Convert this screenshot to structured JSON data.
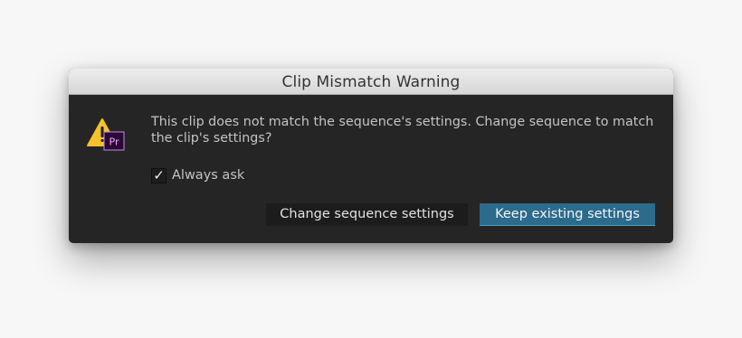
{
  "dialog": {
    "title": "Clip Mismatch Warning",
    "icon": "warning-premiere-icon",
    "message": "This clip does not match the sequence's settings. Change sequence to match the clip's settings?",
    "always_ask": {
      "checked": true,
      "check_glyph": "✓",
      "label": "Always ask"
    },
    "buttons": {
      "change": "Change sequence settings",
      "keep": "Keep existing settings"
    },
    "colors": {
      "warning_yellow": "#f5c22c",
      "premiere_purple": "#2a0a33",
      "premiere_text": "#e9a6ff",
      "primary_button": "#2c6b8c"
    }
  }
}
